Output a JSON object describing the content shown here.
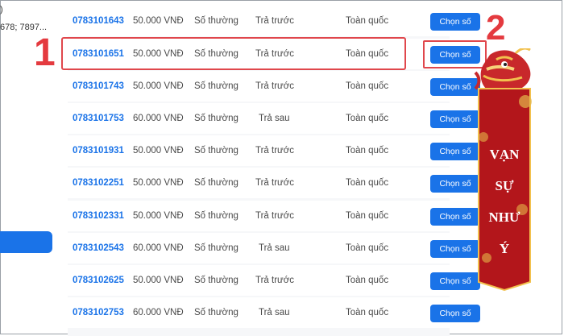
{
  "left": {
    "line1": ")",
    "line2": "678; 7897..."
  },
  "colors": {
    "accent": "#1a73e8",
    "highlight": "#e43a3f",
    "banner": "#b3161b",
    "gold": "#f2c14e"
  },
  "rows": [
    {
      "number": "0783101643",
      "price": "50.000 VNĐ",
      "kind": "Số thường",
      "payment": "Trả trước",
      "area": "Toàn quốc",
      "button": "Chọn số"
    },
    {
      "number": "0783101651",
      "price": "50.000 VNĐ",
      "kind": "Số thường",
      "payment": "Trả trước",
      "area": "Toàn quốc",
      "button": "Chọn số"
    },
    {
      "number": "0783101743",
      "price": "50.000 VNĐ",
      "kind": "Số thường",
      "payment": "Trả trước",
      "area": "Toàn quốc",
      "button": "Chọn số"
    },
    {
      "number": "0783101753",
      "price": "60.000 VNĐ",
      "kind": "Số thường",
      "payment": "Trả sau",
      "area": "Toàn quốc",
      "button": "Chọn số"
    },
    {
      "number": "0783101931",
      "price": "50.000 VNĐ",
      "kind": "Số thường",
      "payment": "Trả trước",
      "area": "Toàn quốc",
      "button": "Chọn số"
    },
    {
      "number": "0783102251",
      "price": "50.000 VNĐ",
      "kind": "Số thường",
      "payment": "Trả trước",
      "area": "Toàn quốc",
      "button": "Chọn số"
    },
    {
      "number": "0783102331",
      "price": "50.000 VNĐ",
      "kind": "Số thường",
      "payment": "Trả trước",
      "area": "Toàn quốc",
      "button": "Chọn số"
    },
    {
      "number": "0783102543",
      "price": "60.000 VNĐ",
      "kind": "Số thường",
      "payment": "Trả sau",
      "area": "Toàn quốc",
      "button": "Chọn số"
    },
    {
      "number": "0783102625",
      "price": "50.000 VNĐ",
      "kind": "Số thường",
      "payment": "Trả trước",
      "area": "Toàn quốc",
      "button": "Chọn số"
    },
    {
      "number": "0783102753",
      "price": "60.000 VNĐ",
      "kind": "Số thường",
      "payment": "Trả sau",
      "area": "Toàn quốc",
      "button": "Chọn số"
    }
  ],
  "annotations": {
    "step1": "1",
    "step2": "2"
  },
  "banner": {
    "line1": "VẠN",
    "line2": "SỰ",
    "line3": "NHƯ",
    "line4": "Ý"
  }
}
